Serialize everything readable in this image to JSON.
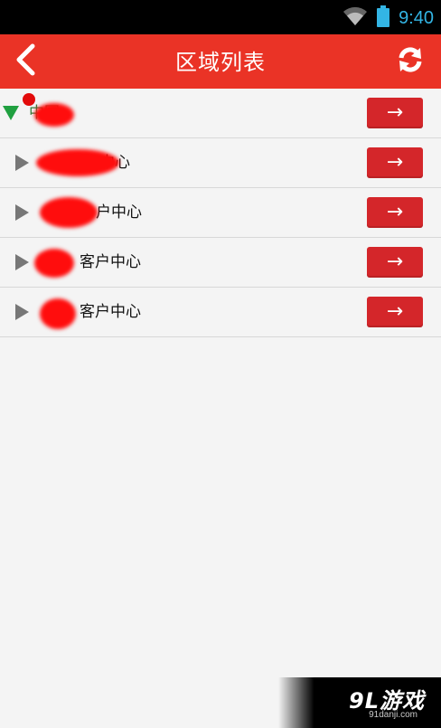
{
  "status_bar": {
    "time": "9:40",
    "icons": [
      "wifi-icon",
      "battery-icon"
    ],
    "clock_color": "#33b5e5"
  },
  "header": {
    "title": "区域列表",
    "back_icon": "chevron-left-icon",
    "refresh_icon": "refresh-icon",
    "background_color": "#ea3326"
  },
  "regions": [
    {
      "label": "中国",
      "expanded": true,
      "button": "→"
    },
    {
      "label": "客户中心",
      "expanded": false,
      "button": "→"
    },
    {
      "label": "户中心",
      "expanded": false,
      "button": "→"
    },
    {
      "label": "客户中心",
      "expanded": false,
      "button": "→"
    },
    {
      "label": "客户中心",
      "expanded": false,
      "button": "→"
    }
  ],
  "watermark": {
    "logo": "9L游戏",
    "url": "91danji.com"
  }
}
